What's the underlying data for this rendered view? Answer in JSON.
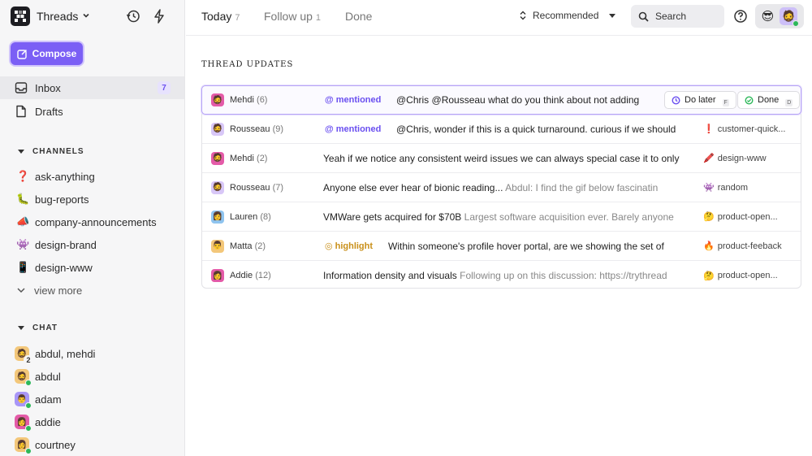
{
  "sidebar": {
    "workspace": "Threads",
    "compose_label": "Compose",
    "nav": [
      {
        "label": "Inbox",
        "badge": "7"
      },
      {
        "label": "Drafts"
      }
    ],
    "channels_heading": "CHANNELS",
    "channels": [
      {
        "emoji": "❓",
        "name": "ask-anything"
      },
      {
        "emoji": "🐛",
        "name": "bug-reports"
      },
      {
        "emoji": "📣",
        "name": "company-announcements"
      },
      {
        "emoji": "👾",
        "name": "design-brand"
      },
      {
        "emoji": "📱",
        "name": "design-www"
      }
    ],
    "view_more": "view more",
    "chat_heading": "CHAT",
    "chats": [
      {
        "name": "abdul, mehdi",
        "count": "2"
      },
      {
        "name": "abdul"
      },
      {
        "name": "adam"
      },
      {
        "name": "addie"
      },
      {
        "name": "courtney"
      }
    ]
  },
  "topbar": {
    "tabs": [
      {
        "label": "Today",
        "count": "7"
      },
      {
        "label": "Follow up",
        "count": "1"
      },
      {
        "label": "Done",
        "count": ""
      }
    ],
    "sort_label": "Recommended",
    "search_label": "Search",
    "user_emoji": "😎"
  },
  "main": {
    "section_title": "THREAD UPDATES",
    "rows": [
      {
        "name": "Mehdi",
        "count": "(6)",
        "tag": "mentioned",
        "tag_icon": "@",
        "subject": "@Chris @Rousseau what do you think about not adding...",
        "preview": "",
        "later_label": "Do later",
        "later_key": "F",
        "done_label": "Done",
        "done_key": "D"
      },
      {
        "name": "Rousseau",
        "count": "(9)",
        "tag": "mentioned",
        "tag_icon": "@",
        "subject": "@Chris, wonder if this is a quick turnaround. curious if we should",
        "preview": "",
        "channel_emoji": "❗",
        "channel": "customer-quick..."
      },
      {
        "name": "Mehdi",
        "count": "(2)",
        "tag": "",
        "subject": "Yeah if we notice any consistent weird issues we can always special case it to only",
        "preview": "",
        "channel_emoji": "🖍️",
        "channel": "design-www"
      },
      {
        "name": "Rousseau",
        "count": "(7)",
        "tag": "",
        "subject": "Anyone else ever hear of bionic reading...",
        "preview": "Abdul: I find the gif below fascinatin",
        "channel_emoji": "👾",
        "channel": "random"
      },
      {
        "name": "Lauren",
        "count": "(8)",
        "tag": "",
        "subject": "VMWare gets acquired for $70B",
        "preview": "Largest software acquisition ever. Barely anyone",
        "channel_emoji": "🤔",
        "channel": "product-open..."
      },
      {
        "name": "Matta",
        "count": "(2)",
        "tag": "highlight",
        "tag_icon": "◎",
        "subject": "Within someone's profile hover portal, are we showing the set of",
        "preview": "",
        "channel_emoji": "🔥",
        "channel": "product-feeback"
      },
      {
        "name": "Addie",
        "count": "(12)",
        "tag": "",
        "subject": "Information density and visuals",
        "preview": "Following up on this discussion: https://trythread",
        "channel_emoji": "🤔",
        "channel": "product-open..."
      }
    ]
  },
  "colors": {
    "accent": "#7b5ff5",
    "mention": "#6a4ff0",
    "highlight": "#c9901a",
    "online": "#2db85a"
  }
}
